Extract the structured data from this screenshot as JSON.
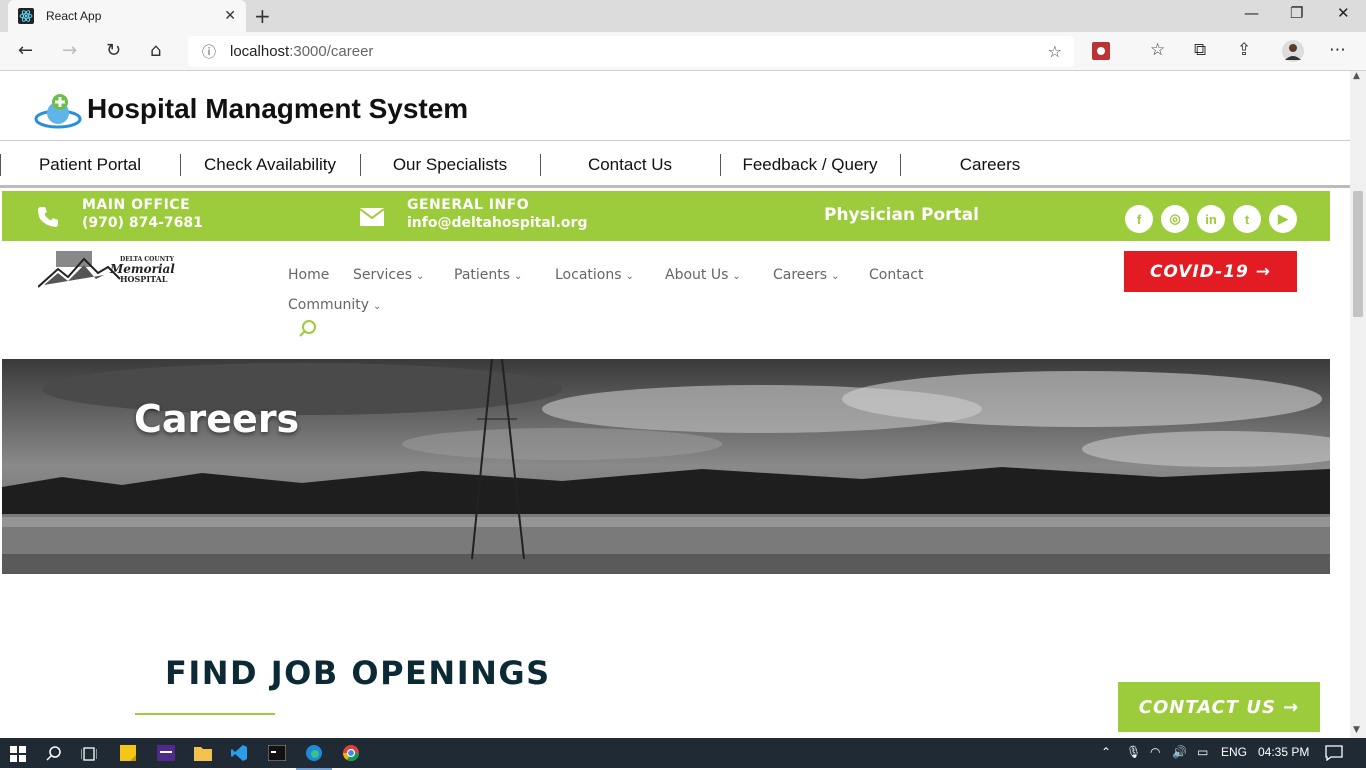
{
  "browser": {
    "tab_title": "React App",
    "tab_close": "✕",
    "new_tab": "+",
    "url_host": "localhost",
    "url_path": ":3000/career",
    "info_icon": "ⓘ",
    "star": "☆",
    "minimize": "—",
    "restore": "❐",
    "close": "✕"
  },
  "app": {
    "title": "Hospital Managment System",
    "nav": [
      "Patient Portal",
      "Check Availability",
      "Our Specialists",
      "Contact Us",
      "Feedback / Query",
      "Careers"
    ]
  },
  "site": {
    "main_office_label": "MAIN OFFICE",
    "main_office_phone": "(970) 874-7681",
    "general_info_label": "GENERAL INFO",
    "general_info_email": "info@deltahospital.org",
    "physician_portal": "Physician Portal",
    "social": [
      "f",
      "◎",
      "in",
      "t",
      "▶"
    ],
    "logo_text": [
      "DELTA COUNTY",
      "Memorial",
      "HOSPITAL"
    ],
    "menu": [
      {
        "label": "Home",
        "chev": ""
      },
      {
        "label": "Services",
        "chev": "⌄"
      },
      {
        "label": "Patients",
        "chev": "⌄"
      },
      {
        "label": "Locations",
        "chev": "⌄"
      },
      {
        "label": "About Us",
        "chev": "⌄"
      },
      {
        "label": "Careers",
        "chev": "⌄"
      },
      {
        "label": "Contact",
        "chev": ""
      },
      {
        "label": "Community",
        "chev": "⌄"
      }
    ],
    "covid_button": "COVID-19 →",
    "hero_title": "Careers",
    "section_title": "FIND JOB OPENINGS",
    "contact_button": "CONTACT US →"
  },
  "taskbar": {
    "lang": "ENG",
    "time": "04:35 PM"
  },
  "colors": {
    "green": "#9ccb3b",
    "red": "#e31b23",
    "navy": "#0c2a36"
  }
}
